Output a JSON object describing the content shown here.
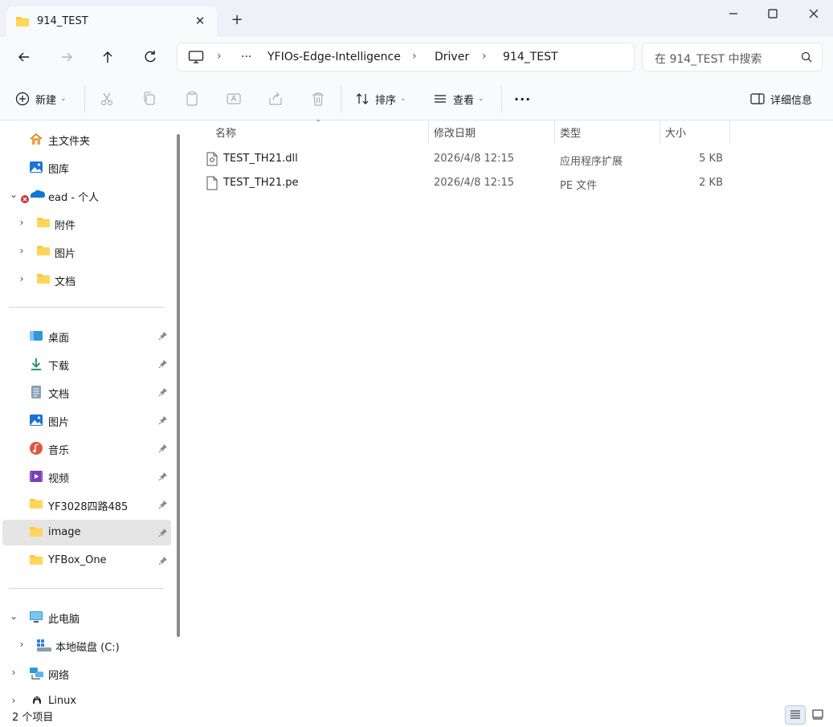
{
  "window": {
    "tab_title": "914_TEST",
    "tab_icon": "folder-icon",
    "new_tab": "+",
    "close_tab": "✕"
  },
  "address": {
    "overflow": "···",
    "crumbs": [
      "YFIOs-Edge-Intelligence",
      "Driver",
      "914_TEST"
    ]
  },
  "search": {
    "placeholder": "在 914_TEST 中搜索"
  },
  "toolbar": {
    "new_label": "新建",
    "sort_label": "排序",
    "view_label": "查看",
    "more_label": "···",
    "details_label": "详细信息"
  },
  "sidebar": {
    "home": "主文件夹",
    "gallery": "图库",
    "onedrive": "ead - 个人",
    "onedrive_children": [
      "附件",
      "图片",
      "文档"
    ],
    "quick_access": [
      {
        "label": "桌面",
        "icon": "desktop-icon"
      },
      {
        "label": "下载",
        "icon": "download-icon"
      },
      {
        "label": "文档",
        "icon": "document-icon"
      },
      {
        "label": "图片",
        "icon": "pictures-icon"
      },
      {
        "label": "音乐",
        "icon": "music-icon"
      },
      {
        "label": "视频",
        "icon": "video-icon"
      },
      {
        "label": "YF3028四路485",
        "icon": "folder-icon"
      },
      {
        "label": "image",
        "icon": "folder-icon"
      },
      {
        "label": "YFBox_One",
        "icon": "folder-icon"
      }
    ],
    "this_pc": "此电脑",
    "local_disk": "本地磁盘 (C:)",
    "network": "网络",
    "linux": "Linux"
  },
  "columns": {
    "name": "名称",
    "date": "修改日期",
    "type": "类型",
    "size": "大小"
  },
  "files": [
    {
      "name": "TEST_TH21.dll",
      "date": "2026/4/8 12:15",
      "type": "应用程序扩展",
      "size": "5 KB",
      "icon": "dll-file-icon"
    },
    {
      "name": "TEST_TH21.pe",
      "date": "2026/4/8 12:15",
      "type": "PE 文件",
      "size": "2 KB",
      "icon": "file-icon"
    }
  ],
  "status": {
    "count": "2 个项目"
  },
  "colors": {
    "accent": "#0067c0",
    "folder": "#ffc83d",
    "selected": "#e5e5e5"
  }
}
